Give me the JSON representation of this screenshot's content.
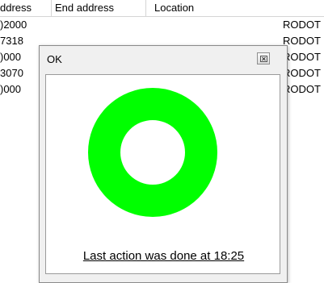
{
  "table": {
    "headers": [
      "ddress",
      "End address",
      "Location"
    ],
    "rows": [
      {
        "start": ")2000",
        "tail": "RODOT"
      },
      {
        "start": "7318",
        "tail": "RODOT"
      },
      {
        "start": ")000",
        "tail": "RODOT"
      },
      {
        "start": "3070",
        "tail": "RODOT"
      },
      {
        "start": ")000",
        "tail": "RODOT"
      }
    ]
  },
  "dialog": {
    "title": "OK",
    "close_icon": "close-icon",
    "status_text": "Last action was done at 18:25",
    "ring_color": "#00ff00"
  }
}
